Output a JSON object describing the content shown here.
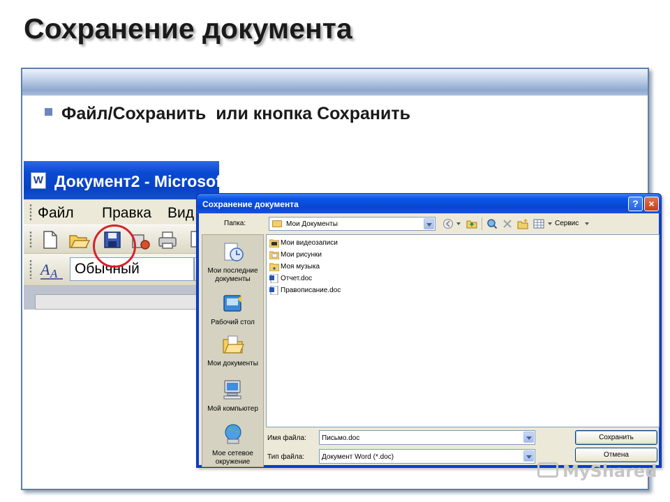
{
  "slide": {
    "title": "Сохранение документа",
    "bullet": "Файл/Сохранить  или кнопка Сохранить"
  },
  "word_window": {
    "title": "Документ2 - Microsof",
    "menu": [
      "Файл",
      "Правка",
      "Вид"
    ],
    "style_value": "Обычный"
  },
  "dialog": {
    "title": "Сохранение документа",
    "folder_label": "Папка:",
    "folder_value": "Мои Документы",
    "tools_label": "Сервис",
    "places": [
      {
        "label": "Мои последние документы",
        "icon": "recent-documents-icon"
      },
      {
        "label": "Рабочий стол",
        "icon": "desktop-icon"
      },
      {
        "label": "Мои документы",
        "icon": "my-documents-icon"
      },
      {
        "label": "Мой компьютер",
        "icon": "my-computer-icon"
      },
      {
        "label": "Мое сетевое окружение",
        "icon": "network-places-icon"
      }
    ],
    "files": [
      {
        "name": "Мои видеозаписи",
        "type": "folder"
      },
      {
        "name": "Мои рисунки",
        "type": "folder"
      },
      {
        "name": "Моя музыка",
        "type": "folder"
      },
      {
        "name": "Отчет.doc",
        "type": "doc"
      },
      {
        "name": "Правописание.doc",
        "type": "doc"
      }
    ],
    "filename_label": "Имя файла:",
    "filename_value": "Письмо.doc",
    "filetype_label": "Тип файла:",
    "filetype_value": "Документ Word (*.doc)",
    "save_button": "Сохранить",
    "cancel_button": "Отмена",
    "help_button": "?",
    "close_button": "×"
  },
  "watermark": "MyShared",
  "colors": {
    "title_bar": "#0a4ad4",
    "frame_border": "#5d7fb0",
    "highlight_circle": "#d8202b",
    "dialog_bg": "#ece9d8"
  }
}
